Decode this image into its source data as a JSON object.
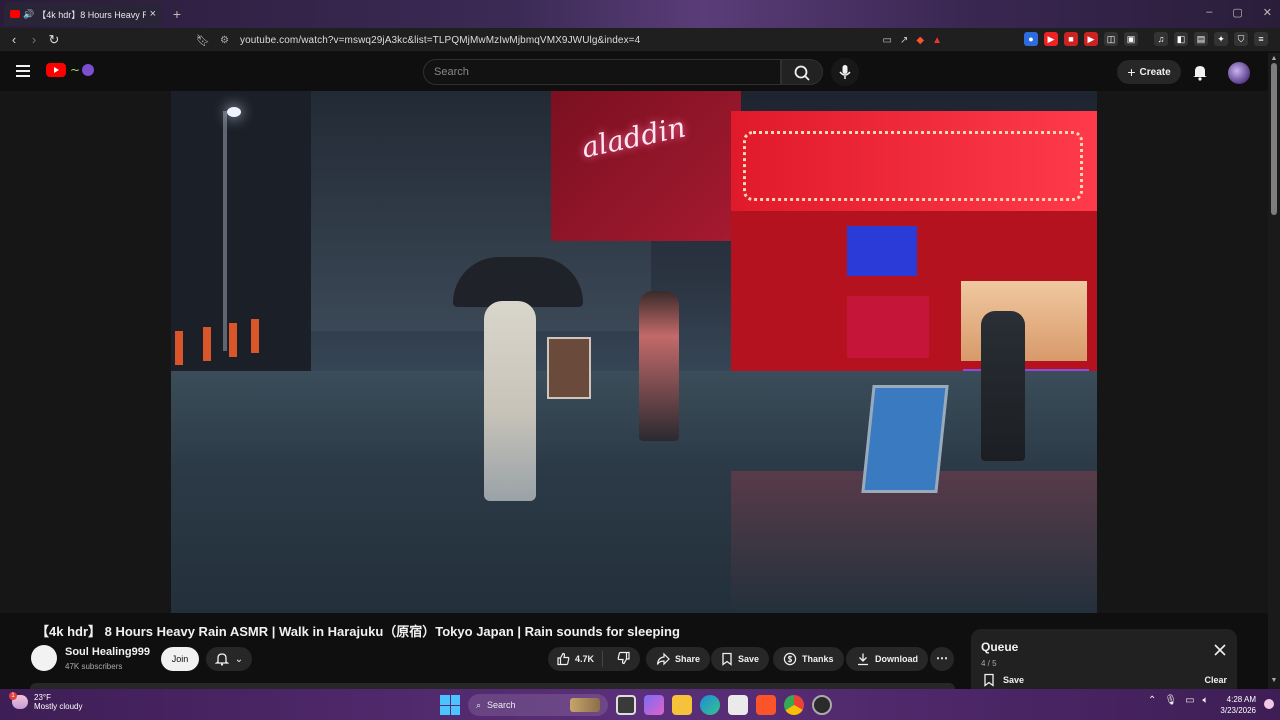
{
  "browser": {
    "tab_title": "【4k hdr】8 Hours Heavy Rain",
    "url": "youtube.com/watch?v=mswq29jA3kc&list=TLPQMjMwMzIwMjbmqVMX9JWUlg&index=4"
  },
  "youtube": {
    "search_placeholder": "Search",
    "create_label": "Create"
  },
  "video": {
    "title": "【4k hdr】 8 Hours Heavy Rain ASMR | Walk in Harajuku（原宿）Tokyo Japan | Rain sounds for sleeping",
    "channel_name": "Soul Healing999",
    "subscribers": "47K subscribers",
    "join_label": "Join",
    "like_count": "4.7K",
    "share_label": "Share",
    "save_label": "Save",
    "thanks_label": "Thanks",
    "download_label": "Download"
  },
  "queue": {
    "title": "Queue",
    "count": "4 / 5",
    "save_label": "Save",
    "clear_label": "Clear"
  },
  "taskbar": {
    "temperature": "23°F",
    "weather": "Mostly cloudy",
    "search_label": "Search",
    "time": "4:28 AM",
    "date": "3/23/2026",
    "weather_badge": "1"
  },
  "colors": {
    "youtube_red": "#ff0000",
    "background": "#0f0f0f",
    "pill": "#272727",
    "taskbar": "#5b2f7a"
  }
}
